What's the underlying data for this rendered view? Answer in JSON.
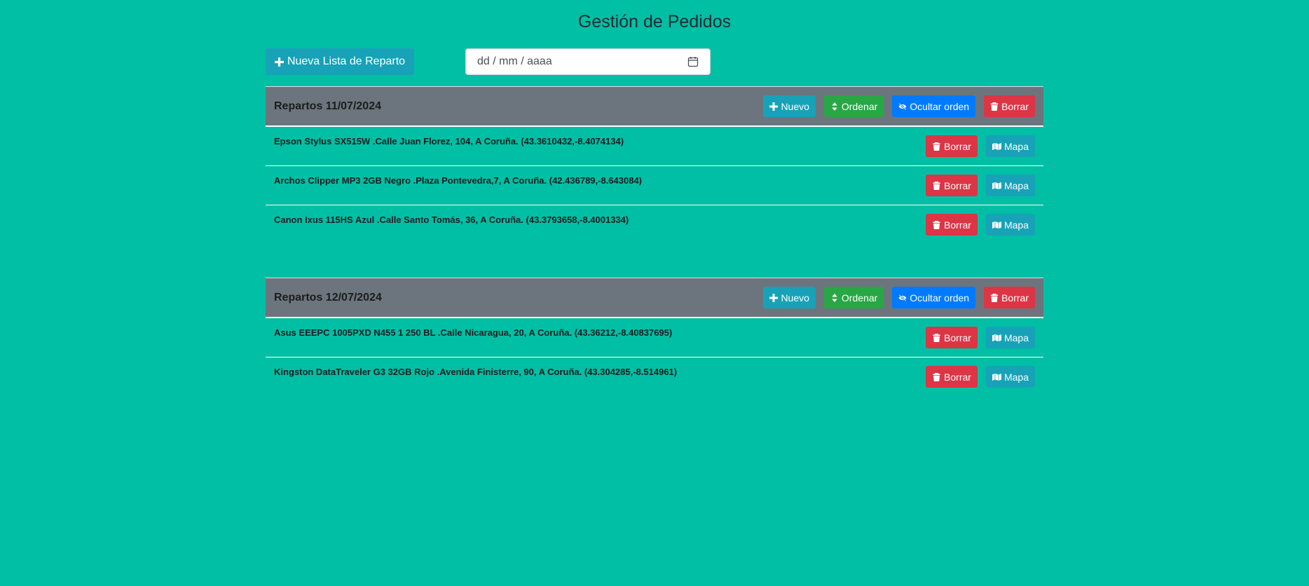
{
  "page": {
    "title": "Gestión de Pedidos"
  },
  "toolbar": {
    "new_list_label": "Nueva Lista de Reparto",
    "date_placeholder": "dd / mm / aaaa"
  },
  "colors": {
    "background": "#00bfa5",
    "header": "#6c757d",
    "info": "#17a2b8",
    "success": "#28a745",
    "primary": "#007bff",
    "danger": "#dc3545"
  },
  "icons": {
    "new": "plus-icon",
    "sort": "sort-icon",
    "hide": "eye-slash-icon",
    "delete": "trash-icon",
    "map": "map-icon",
    "calendar": "calendar-icon"
  },
  "card_actions": {
    "new_label": "Nuevo",
    "sort_label": "Ordenar",
    "hide_label": "Ocultar orden",
    "delete_label": "Borrar"
  },
  "row_actions": {
    "delete_label": "Borrar",
    "map_label": "Mapa"
  },
  "deliveries": [
    {
      "title": "Repartos 11/07/2024",
      "items": [
        {
          "text": "Epson Stylus SX515W .Calle Juan Florez, 104, A Coruña. (43.3610432,-8.4074134)"
        },
        {
          "text": "Archos Clipper MP3 2GB Negro .Plaza Pontevedra,7, A Coruña. (42.436789,-8.643084)"
        },
        {
          "text": "Canon Ixus 115HS Azul .Calle Santo Tomás, 36, A Coruña. (43.3793658,-8.4001334)"
        }
      ]
    },
    {
      "title": "Repartos 12/07/2024",
      "items": [
        {
          "text": "Asus EEEPC 1005PXD N455 1 250 BL .Calle Nicaragua, 20, A Coruña. (43.36212,-8.40837695)"
        },
        {
          "text": "Kingston DataTraveler G3 32GB Rojo .Avenida Finisterre, 90, A Coruña. (43.304285,-8.514961)"
        }
      ]
    }
  ]
}
